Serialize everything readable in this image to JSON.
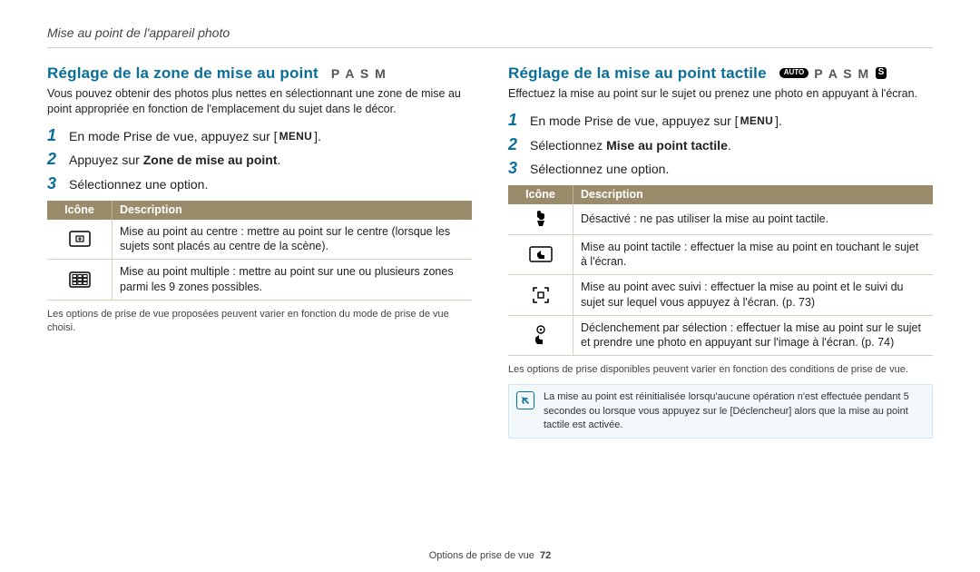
{
  "header": {
    "title": "Mise au point de l'appareil photo"
  },
  "left": {
    "title": "Réglage de la zone de mise au point",
    "modes": {
      "letters": "P A S M",
      "auto": false,
      "s_box": false
    },
    "intro": "Vous pouvez obtenir des photos plus nettes en sélectionnant une zone de mise au point appropriée en fonction de l'emplacement du sujet dans le décor.",
    "steps": [
      {
        "n": "1",
        "pre": "En mode Prise de vue, appuyez sur [",
        "chip": "MENU",
        "post": "]."
      },
      {
        "n": "2",
        "pre": "Appuyez sur ",
        "bold": "Zone de mise au point",
        "post": "."
      },
      {
        "n": "3",
        "pre": "Sélectionnez une option."
      }
    ],
    "table": {
      "head_icon": "Icône",
      "head_desc": "Description",
      "rows": [
        {
          "icon": "center",
          "bold": "Mise au point au centre",
          "text": " : mettre au point sur le centre (lorsque les sujets sont placés au centre de la scène)."
        },
        {
          "icon": "multi",
          "bold": "Mise au point multiple",
          "text": " : mettre au point sur une ou plusieurs zones parmi les 9 zones possibles."
        }
      ]
    },
    "footnote": "Les options de prise de vue proposées peuvent varier en fonction du mode de prise de vue choisi."
  },
  "right": {
    "title": "Réglage de la mise au point tactile",
    "modes": {
      "letters": "P A S M",
      "auto": true,
      "auto_label": "AUTO",
      "s_box": true,
      "s_label": "S"
    },
    "intro": "Effectuez la mise au point sur le sujet ou prenez une photo en appuyant à l'écran.",
    "steps": [
      {
        "n": "1",
        "pre": "En mode Prise de vue, appuyez sur [",
        "chip": "MENU",
        "post": "]."
      },
      {
        "n": "2",
        "pre": "Sélectionnez ",
        "bold": "Mise au point tactile",
        "post": "."
      },
      {
        "n": "3",
        "pre": "Sélectionnez une option."
      }
    ],
    "table": {
      "head_icon": "Icône",
      "head_desc": "Description",
      "rows": [
        {
          "icon": "hand-off",
          "bold": "Désactivé",
          "text": " : ne pas utiliser la mise au point tactile."
        },
        {
          "icon": "touch-lcd",
          "bold": "Mise au point tactile",
          "text": " : effectuer la mise au point en touchant le sujet à l'écran."
        },
        {
          "icon": "track",
          "bold": "Mise au point avec suivi",
          "text": " : effectuer la mise au point et le suivi du sujet sur lequel vous appuyez à l'écran. (p. 73)"
        },
        {
          "icon": "hand-circle",
          "bold": "Déclenchement par sélection",
          "text": " : effectuer la mise au point sur le sujet et prendre une photo en appuyant sur l'image à l'écran. (p. 74)"
        }
      ]
    },
    "footnote": "Les options de prise disponibles peuvent varier en fonction des conditions de prise de vue.",
    "note": "La mise au point est réinitialisée lorsqu'aucune opération n'est effectuée pendant 5 secondes ou lorsque vous appuyez sur le [",
    "note_bold": "Déclencheur",
    "note_post": "] alors que la mise au point tactile est activée."
  },
  "footer": {
    "label": "Options de prise de vue",
    "page": "72"
  }
}
